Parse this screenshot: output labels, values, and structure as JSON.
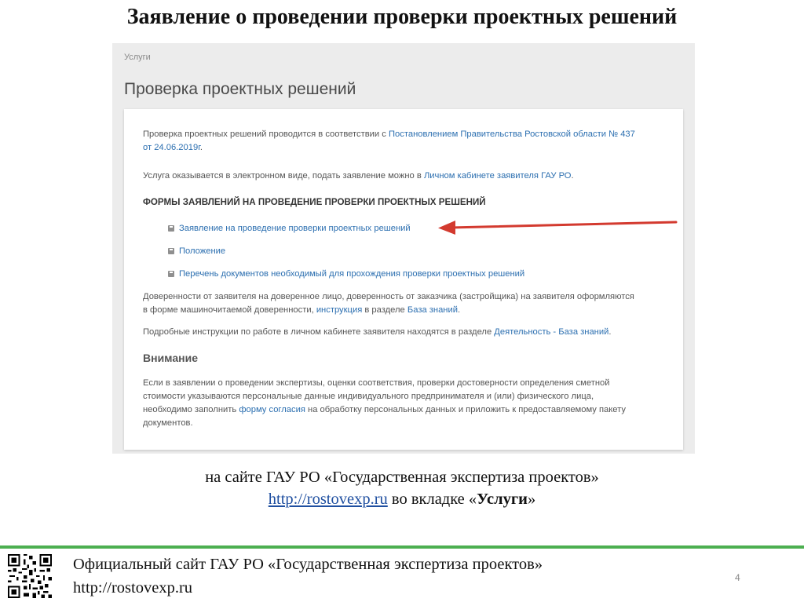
{
  "slide": {
    "title": "Заявление о проведении проверки проектных решений",
    "page_number": "4"
  },
  "screenshot": {
    "breadcrumb": "Услуги",
    "heading": "Проверка проектных решений",
    "intro": {
      "text1": "Проверка проектных решений проводится в соответствии с ",
      "link1": "Постановлением Правительства Ростовской области № 437",
      "link1b": "от 24.06.2019г",
      "text1_end": "."
    },
    "service": {
      "text": "Услуга оказывается в электронном виде, подать заявление можно в ",
      "link": "Личном кабинете заявителя ГАУ РО",
      "text_end": "."
    },
    "forms_heading": "ФОРМЫ ЗАЯВЛЕНИЙ НА ПРОВЕДЕНИЕ ПРОВЕРКИ ПРОЕКТНЫХ РЕШЕНИЙ",
    "form_items": [
      "Заявление на проведение проверки проектных решений",
      "Положение",
      "Перечень документов необходимый для прохождения проверки проектных решений"
    ],
    "poa": {
      "line1": "Доверенности от заявителя на доверенное лицо, доверенность от заказчика (застройщика) на заявителя оформляются",
      "line2_a": "в форме машиночитаемой доверенности, ",
      "link_instruction": "инструкция",
      "line2_b": " в разделе ",
      "link_kb": "База знаний",
      "line2_end": "."
    },
    "instructions": {
      "text": "Подробные инструкции по работе в личном кабинете заявителя находятся в разделе ",
      "link": "Деятельность - База знаний",
      "text_end": "."
    },
    "attention_heading": "Внимание",
    "attention": {
      "line1": "Если в заявлении о проведении экспертизы, оценки соответствия, проверки достоверности определения сметной",
      "line2": "стоимости указываются персональные данные индивидуального предпринимателя и (или) физического лица,",
      "line3_a": "необходимо заполнить ",
      "link": "форму согласия",
      "line3_b": " на обработку персональных данных и приложить к предоставляемому пакету",
      "line4": "документов."
    }
  },
  "caption": {
    "line1": "на сайте ГАУ РО «Государственная экспертиза проектов»",
    "url": "http://rostovexp.ru",
    "line2_a": " во вкладке «",
    "line2_bold": "Услуги",
    "line2_b": "»"
  },
  "footer": {
    "line1": "Официальный сайт ГАУ РО «Государственная экспертиза проектов»",
    "line2": "http://rostovexp.ru"
  },
  "colors": {
    "link": "#2c6fb0",
    "footer_rule": "#4caf50",
    "arrow": "#d33a2f"
  },
  "icons": [
    "floppy-disk-icon",
    "red-arrow-icon",
    "qr-code"
  ]
}
